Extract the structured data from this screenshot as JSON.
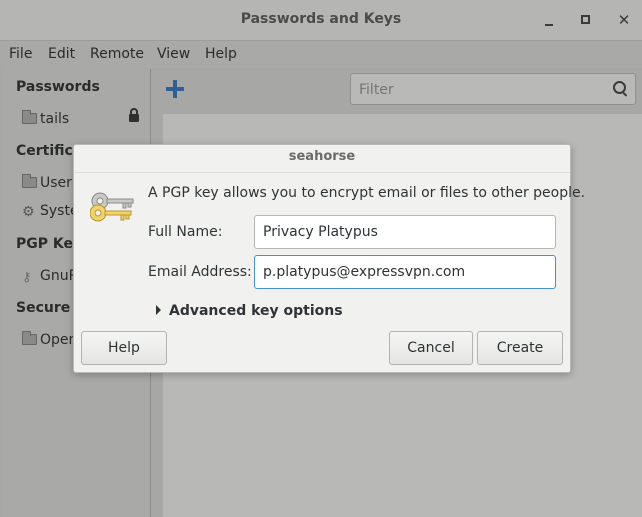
{
  "window": {
    "title": "Passwords and Keys",
    "controls": {
      "minimize": "minimize",
      "maximize": "maximize",
      "close": "✕"
    }
  },
  "menubar": {
    "items": [
      "File",
      "Edit",
      "Remote",
      "View",
      "Help"
    ]
  },
  "sidebar": {
    "sections": [
      {
        "heading": "Passwords",
        "item": "tails"
      },
      {
        "heading": "Certifica",
        "item": "User"
      },
      {
        "heading": "",
        "item": "Syste"
      },
      {
        "heading": "PGP Key",
        "item": "GnuP"
      },
      {
        "heading": "Secure S",
        "item": "Open"
      }
    ]
  },
  "toolbar": {
    "filter_placeholder": "Filter"
  },
  "dialog": {
    "title": "seahorse",
    "intro": "A PGP key allows you to encrypt email or files to other people.",
    "full_name_label": "Full Name:",
    "full_name_value": "Privacy Platypus",
    "email_label": "Email Address:",
    "email_value": "p.platypus@expressvpn.com",
    "advanced_label": "Advanced key options",
    "help_label": "Help",
    "cancel_label": "Cancel",
    "create_label": "Create"
  },
  "colors": {
    "accent": "#4a90d9",
    "add_icon": "#2f5f96"
  },
  "icons": {
    "add": "plus-icon",
    "search": "search-icon",
    "lock": "lock-icon",
    "keys": "keys-icon"
  }
}
